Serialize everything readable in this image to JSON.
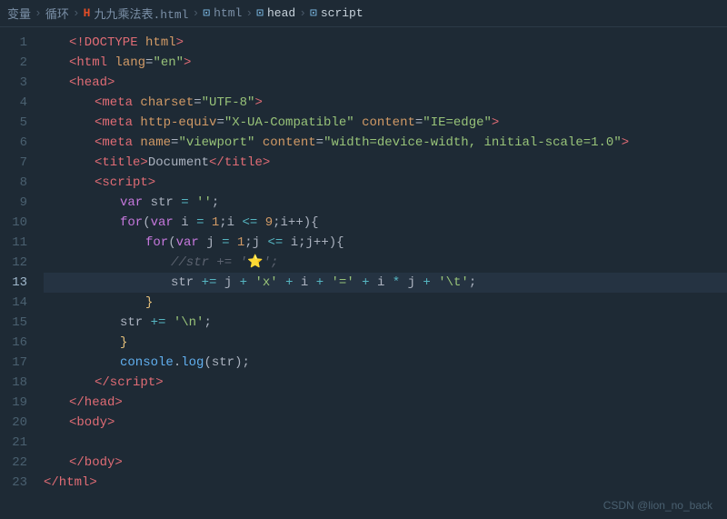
{
  "breadcrumb": {
    "items": [
      {
        "label": "变量",
        "icon": "",
        "type": "text"
      },
      {
        "label": "循环",
        "icon": "",
        "type": "text"
      },
      {
        "label": "九九乘法表.html",
        "icon": "html5",
        "type": "file"
      },
      {
        "label": "html",
        "icon": "tag",
        "type": "node"
      },
      {
        "label": "head",
        "icon": "tag",
        "type": "node"
      },
      {
        "label": "script",
        "icon": "tag",
        "type": "node"
      }
    ]
  },
  "watermark": "CSDN @lion_no_back",
  "lines": [
    {
      "num": 1,
      "content": "doctype"
    },
    {
      "num": 2,
      "content": "html-open"
    },
    {
      "num": 3,
      "content": "head-open"
    },
    {
      "num": 4,
      "content": "meta-charset"
    },
    {
      "num": 5,
      "content": "meta-http"
    },
    {
      "num": 6,
      "content": "meta-viewport"
    },
    {
      "num": 7,
      "content": "title"
    },
    {
      "num": 8,
      "content": "script-open"
    },
    {
      "num": 9,
      "content": "var-str"
    },
    {
      "num": 10,
      "content": "for-outer"
    },
    {
      "num": 11,
      "content": "for-inner"
    },
    {
      "num": 12,
      "content": "comment-str"
    },
    {
      "num": 13,
      "content": "str-concat"
    },
    {
      "num": 14,
      "content": "close-inner"
    },
    {
      "num": 15,
      "content": "str-newline"
    },
    {
      "num": 16,
      "content": "close-outer"
    },
    {
      "num": 17,
      "content": "console-log"
    },
    {
      "num": 18,
      "content": "script-close"
    },
    {
      "num": 19,
      "content": "head-close"
    },
    {
      "num": 20,
      "content": "body-open"
    },
    {
      "num": 21,
      "content": "empty"
    },
    {
      "num": 22,
      "content": "body-close"
    },
    {
      "num": 23,
      "content": "html-close"
    }
  ]
}
